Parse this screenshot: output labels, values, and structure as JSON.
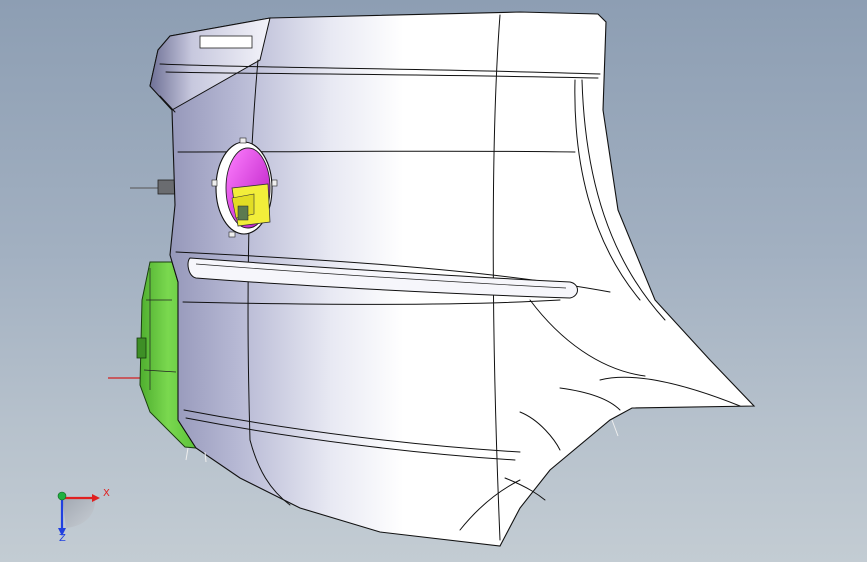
{
  "viewport": {
    "name": "3d-cad-viewport",
    "background_top": "#8d9eb3",
    "background_bottom": "#c3ccd3"
  },
  "model": {
    "part": "rear-bumper-cover",
    "body_color": "#ffffff",
    "shade_color": "#8e90b4",
    "bracket_color": "#6fcf43",
    "lamp_housing_color": "#e233e6",
    "lamp_insert_color": "#f2ee3a"
  },
  "triad": {
    "x_label": "X",
    "z_label": "Z",
    "x_color": "#e02020",
    "y_color": "#20b040",
    "z_color": "#2040e0"
  }
}
